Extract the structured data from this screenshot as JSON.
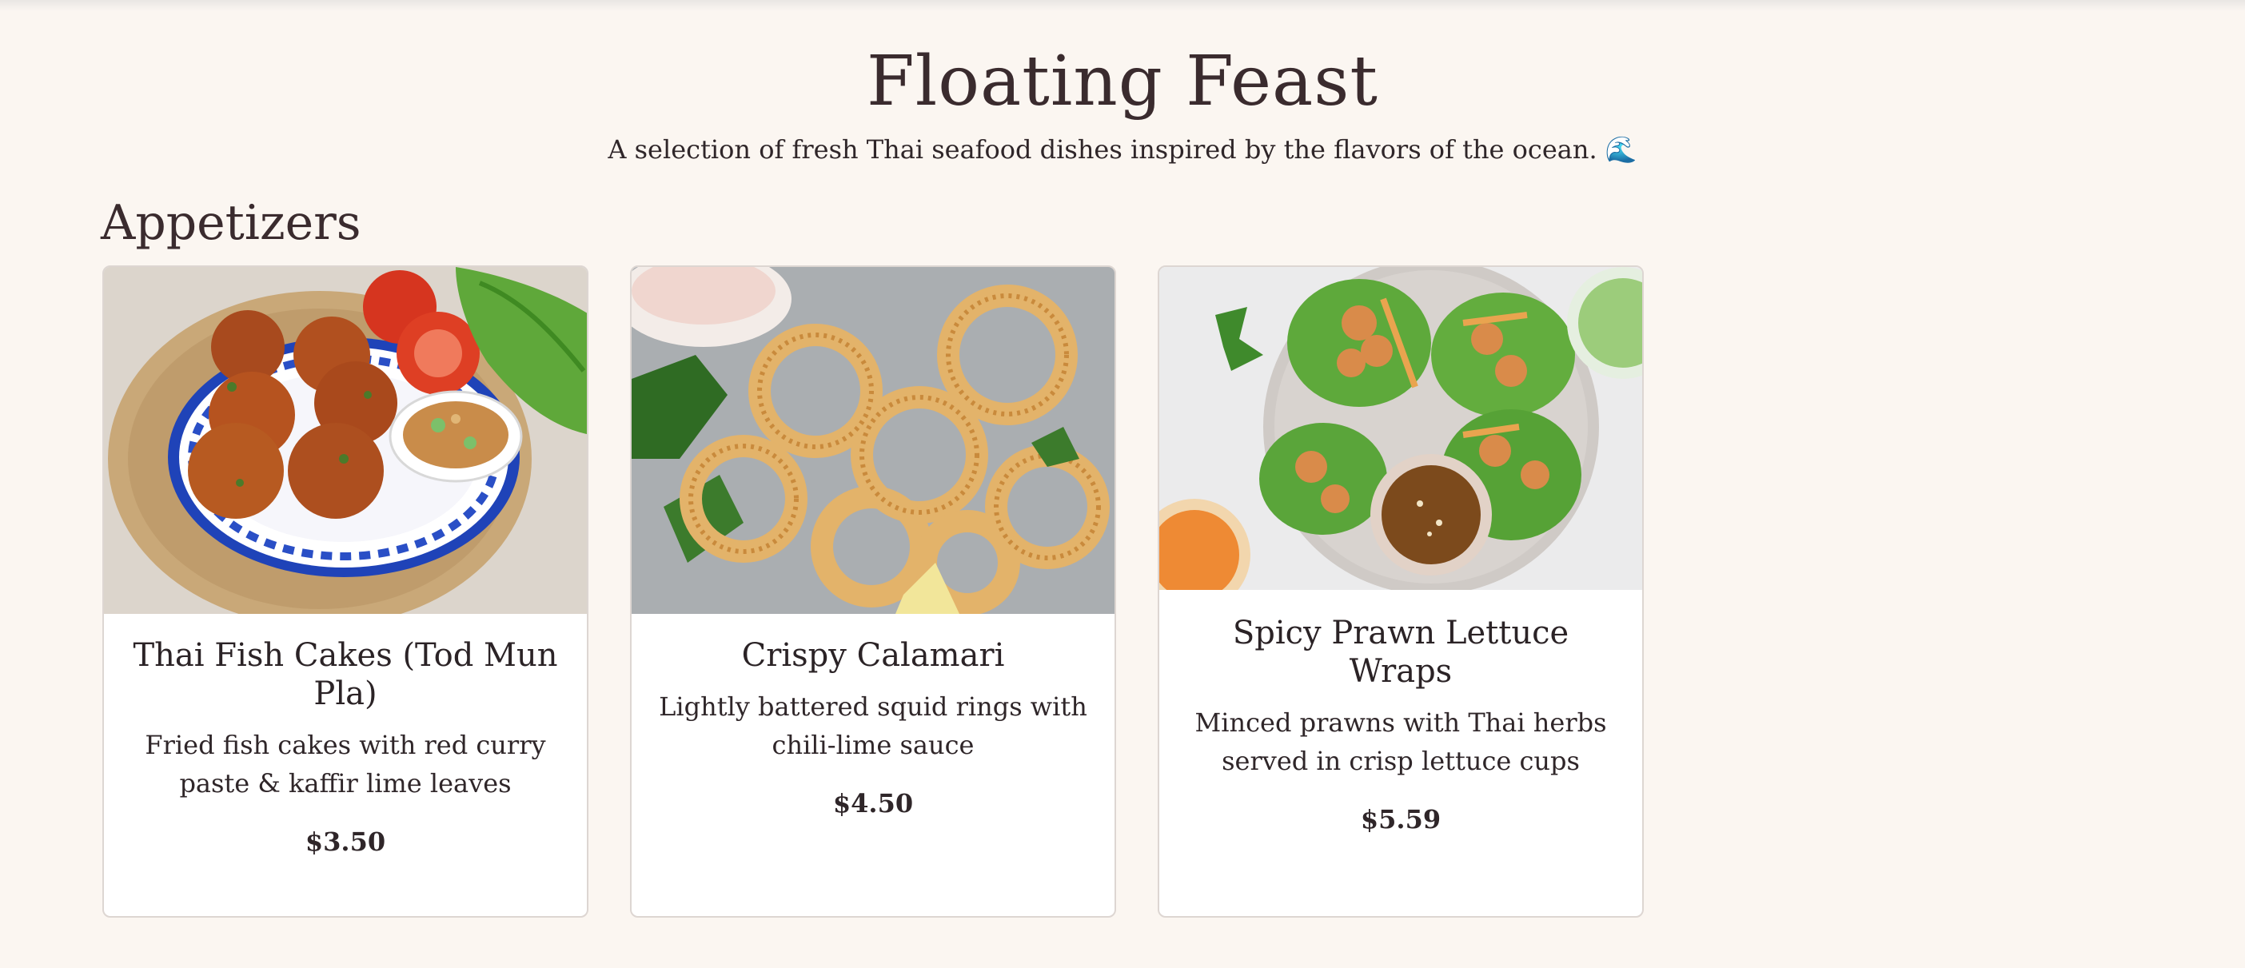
{
  "header": {
    "title": "Floating Feast",
    "subtitle": "A selection of fresh Thai seafood dishes inspired by the flavors of the ocean. 🌊"
  },
  "sections": [
    {
      "title": "Appetizers",
      "items": [
        {
          "name": "Thai Fish Cakes (Tod Mun Pla)",
          "description": "Fried fish cakes with red curry paste & kaffir lime leaves",
          "price": "$3.50",
          "image_icon": "fish-cakes-photo"
        },
        {
          "name": "Crispy Calamari",
          "description": "Lightly battered squid rings with chili-lime sauce",
          "price": "$4.50",
          "image_icon": "calamari-photo"
        },
        {
          "name": "Spicy Prawn Lettuce Wraps",
          "description": "Minced prawns with Thai herbs served in crisp lettuce cups",
          "price": "$5.59",
          "image_icon": "prawn-wraps-photo"
        }
      ]
    }
  ],
  "colors": {
    "background": "#fbf6f1",
    "card": "#ffffff",
    "text": "#2b2326",
    "card_border": "#ddd6d2"
  }
}
